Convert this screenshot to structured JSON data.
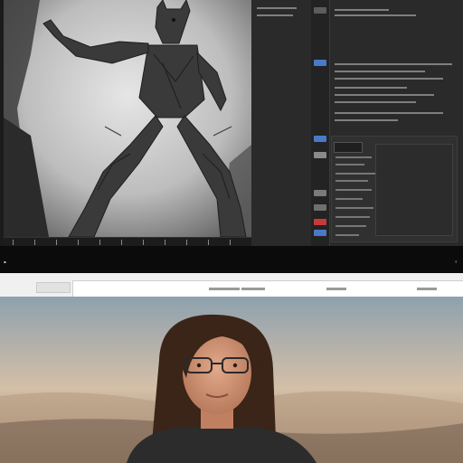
{
  "editor": {
    "panel_title": "",
    "status_left": "",
    "status_right": "",
    "accent_color": "#4a79c8",
    "alert_color": "#c43b3b"
  },
  "browser": {
    "address_text": ""
  },
  "icons": {
    "status_left": "square-icon",
    "status_right": "share-icon"
  }
}
